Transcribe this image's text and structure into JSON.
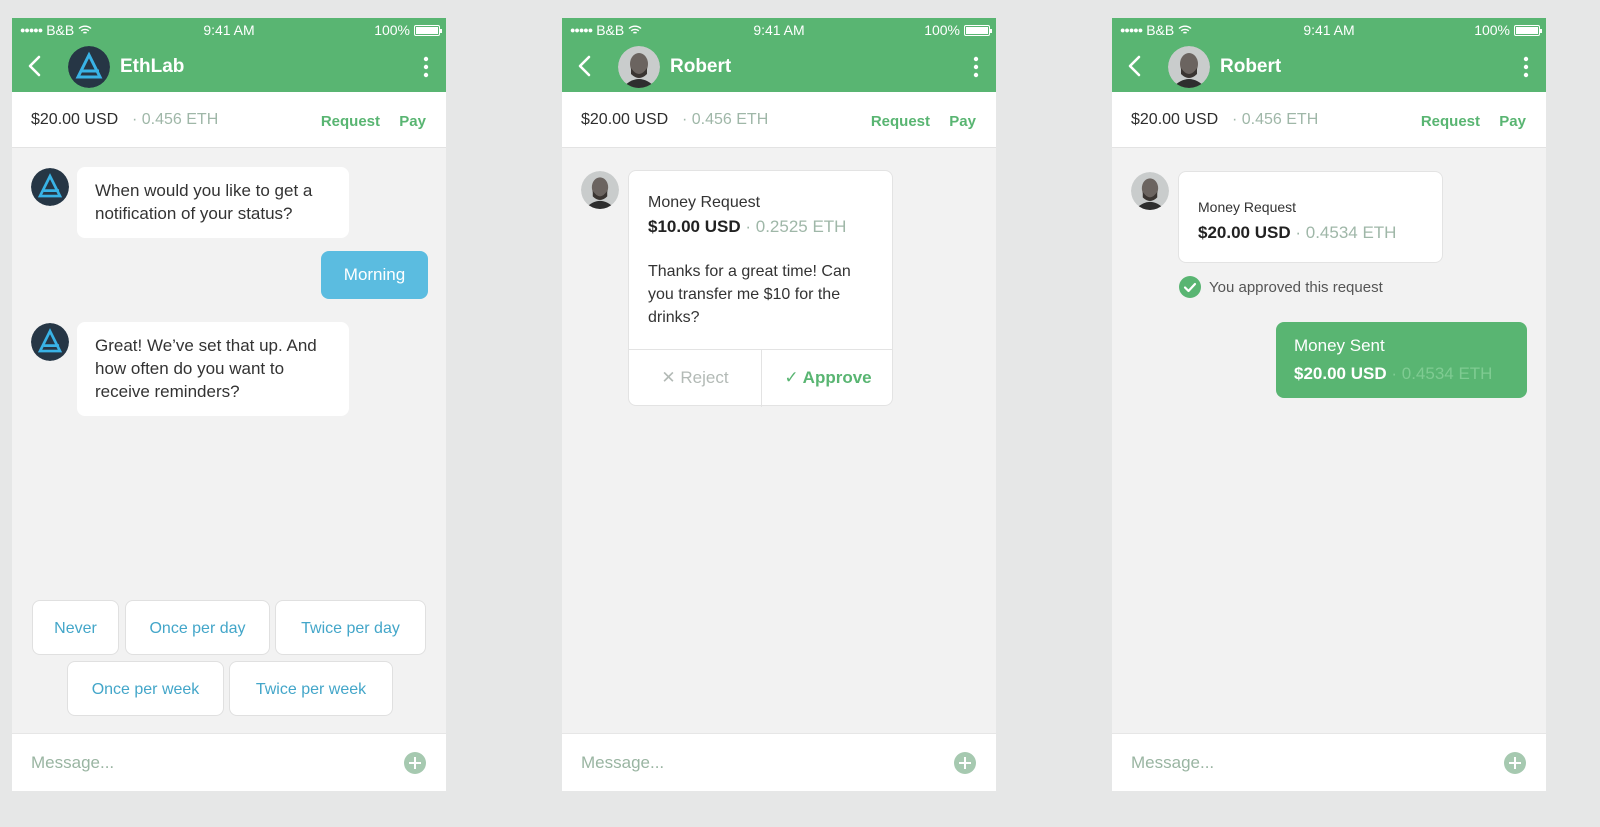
{
  "colors": {
    "green": "#59b572",
    "blue": "#5bbce0",
    "link_blue": "#43a6c9",
    "muted_green": "#9fb7a8"
  },
  "status": {
    "carrier": "B&B",
    "time": "9:41 AM",
    "battery": "100%"
  },
  "balance": {
    "usd": "$20.00 USD",
    "eth": "· 0.456 ETH",
    "request_label": "Request",
    "pay_label": "Pay"
  },
  "composer": {
    "placeholder": "Message..."
  },
  "screen1": {
    "contact": "EthLab",
    "messages": [
      {
        "text": "When would you like to get a notification of your status?"
      },
      {
        "text": "Morning"
      },
      {
        "text": "Great! We’ve set that up. And how often do you want to receive reminders?"
      }
    ],
    "quick_replies": [
      "Never",
      "Once per day",
      "Twice per day",
      "Once per week",
      "Twice per week"
    ]
  },
  "screen2": {
    "contact": "Robert",
    "request": {
      "title": "Money Request",
      "usd": "$10.00 USD",
      "eth": "· 0.2525 ETH",
      "note": "Thanks for a great time! Can you transfer me $10 for the drinks?",
      "reject_label": "✕ Reject",
      "approve_label": "✓ Approve"
    }
  },
  "screen3": {
    "contact": "Robert",
    "request": {
      "title": "Money Request",
      "usd": "$20.00 USD",
      "eth": "· 0.4534 ETH"
    },
    "approved_text": "You approved this request",
    "sent": {
      "title": "Money Sent",
      "usd": "$20.00 USD",
      "eth": "· 0.4534 ETH"
    }
  }
}
